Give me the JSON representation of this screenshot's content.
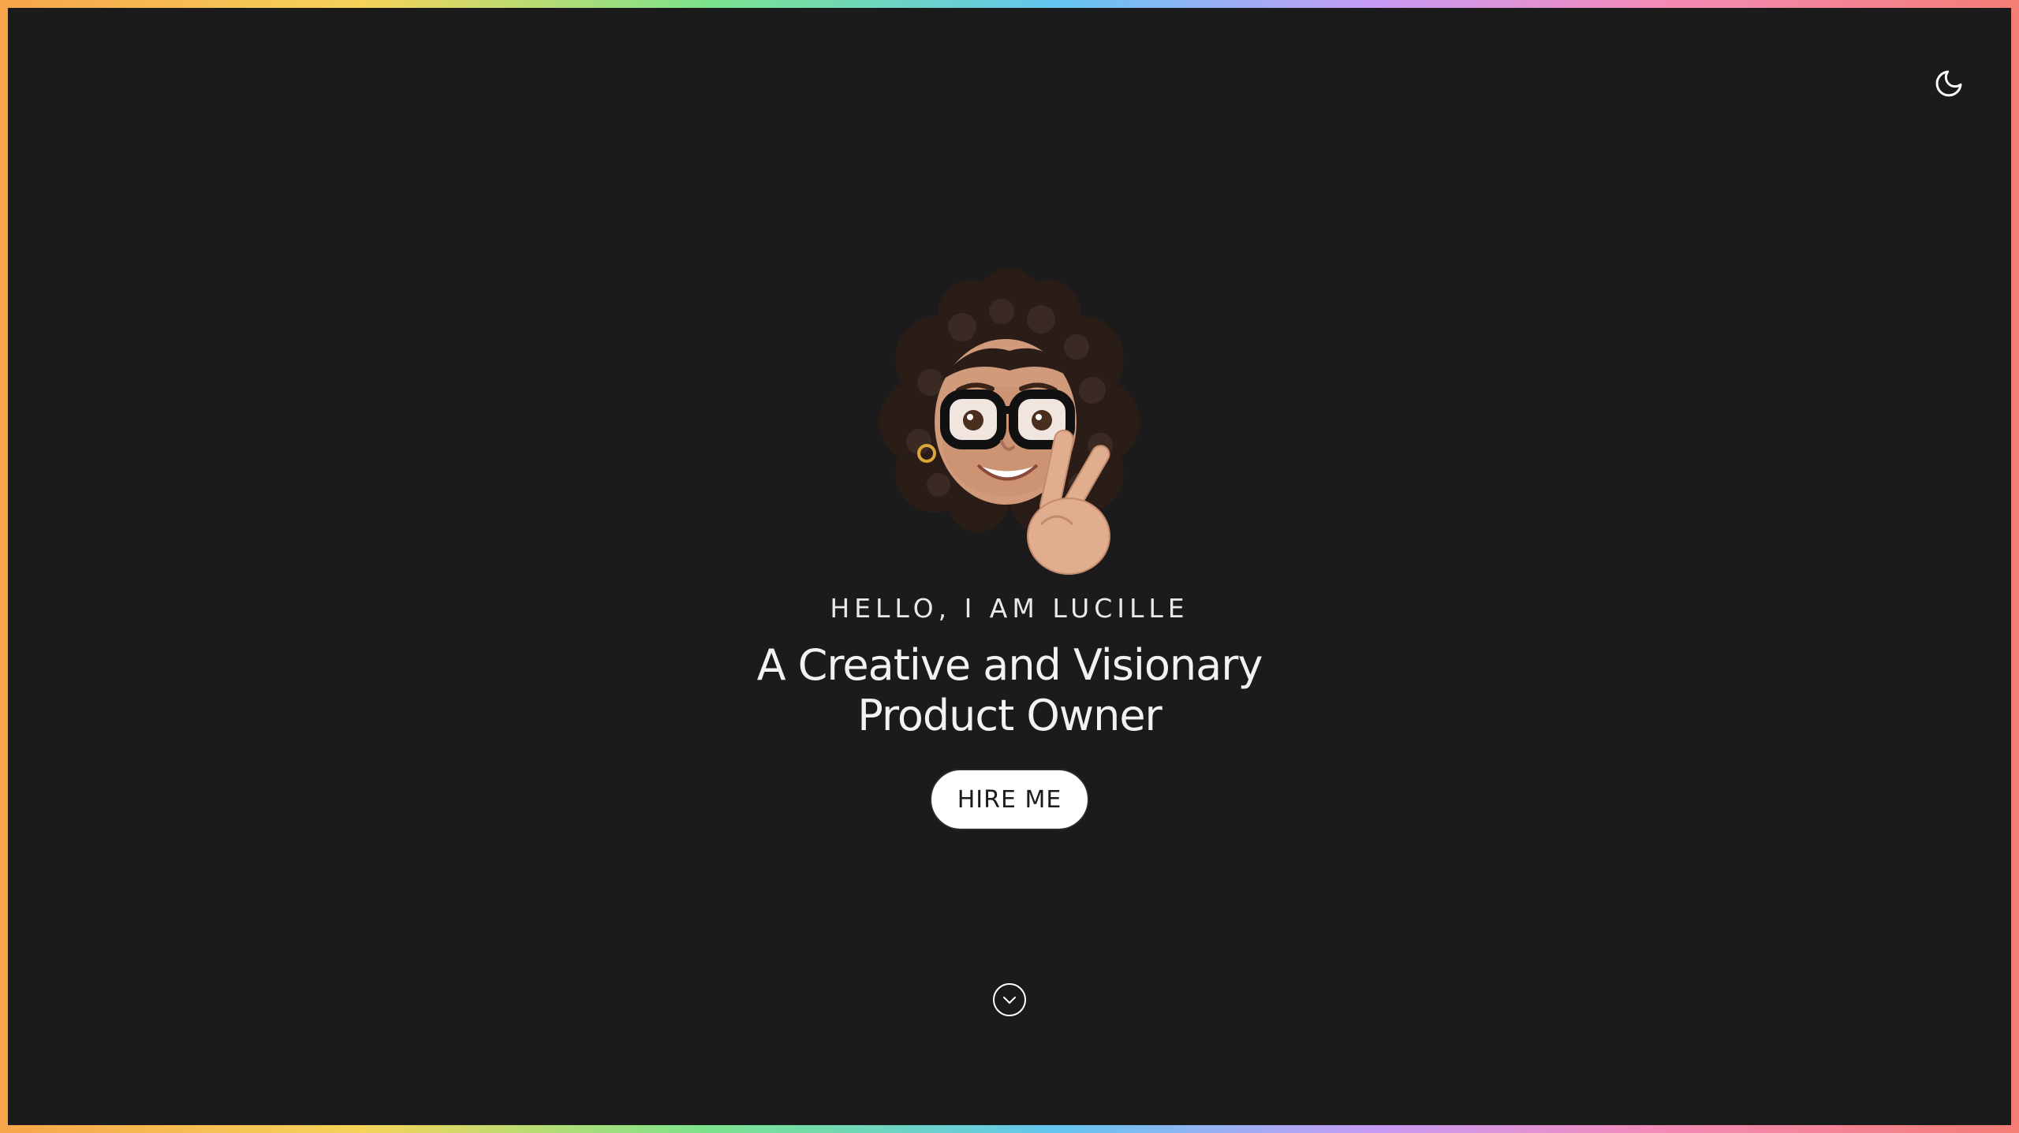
{
  "header": {
    "theme_toggle_icon": "moon-icon"
  },
  "hero": {
    "avatar_icon": "memoji-avatar-icon",
    "greeting": "HELLO, I AM LUCILLE",
    "headline_line1": "A Creative and Visionary",
    "headline_line2": "Product Owner",
    "cta_label": "HIRE ME",
    "scroll_icon": "chevron-down-circle-icon"
  },
  "colors": {
    "background": "#1b1b1b",
    "text": "#f2f2f2",
    "button_bg": "#ffffff",
    "button_text": "#1b1b1b",
    "border_gradient": [
      "#f6a54a",
      "#f5d45a",
      "#7be38c",
      "#62c7ee",
      "#c79bf5",
      "#f38bb8",
      "#f47d74"
    ]
  }
}
